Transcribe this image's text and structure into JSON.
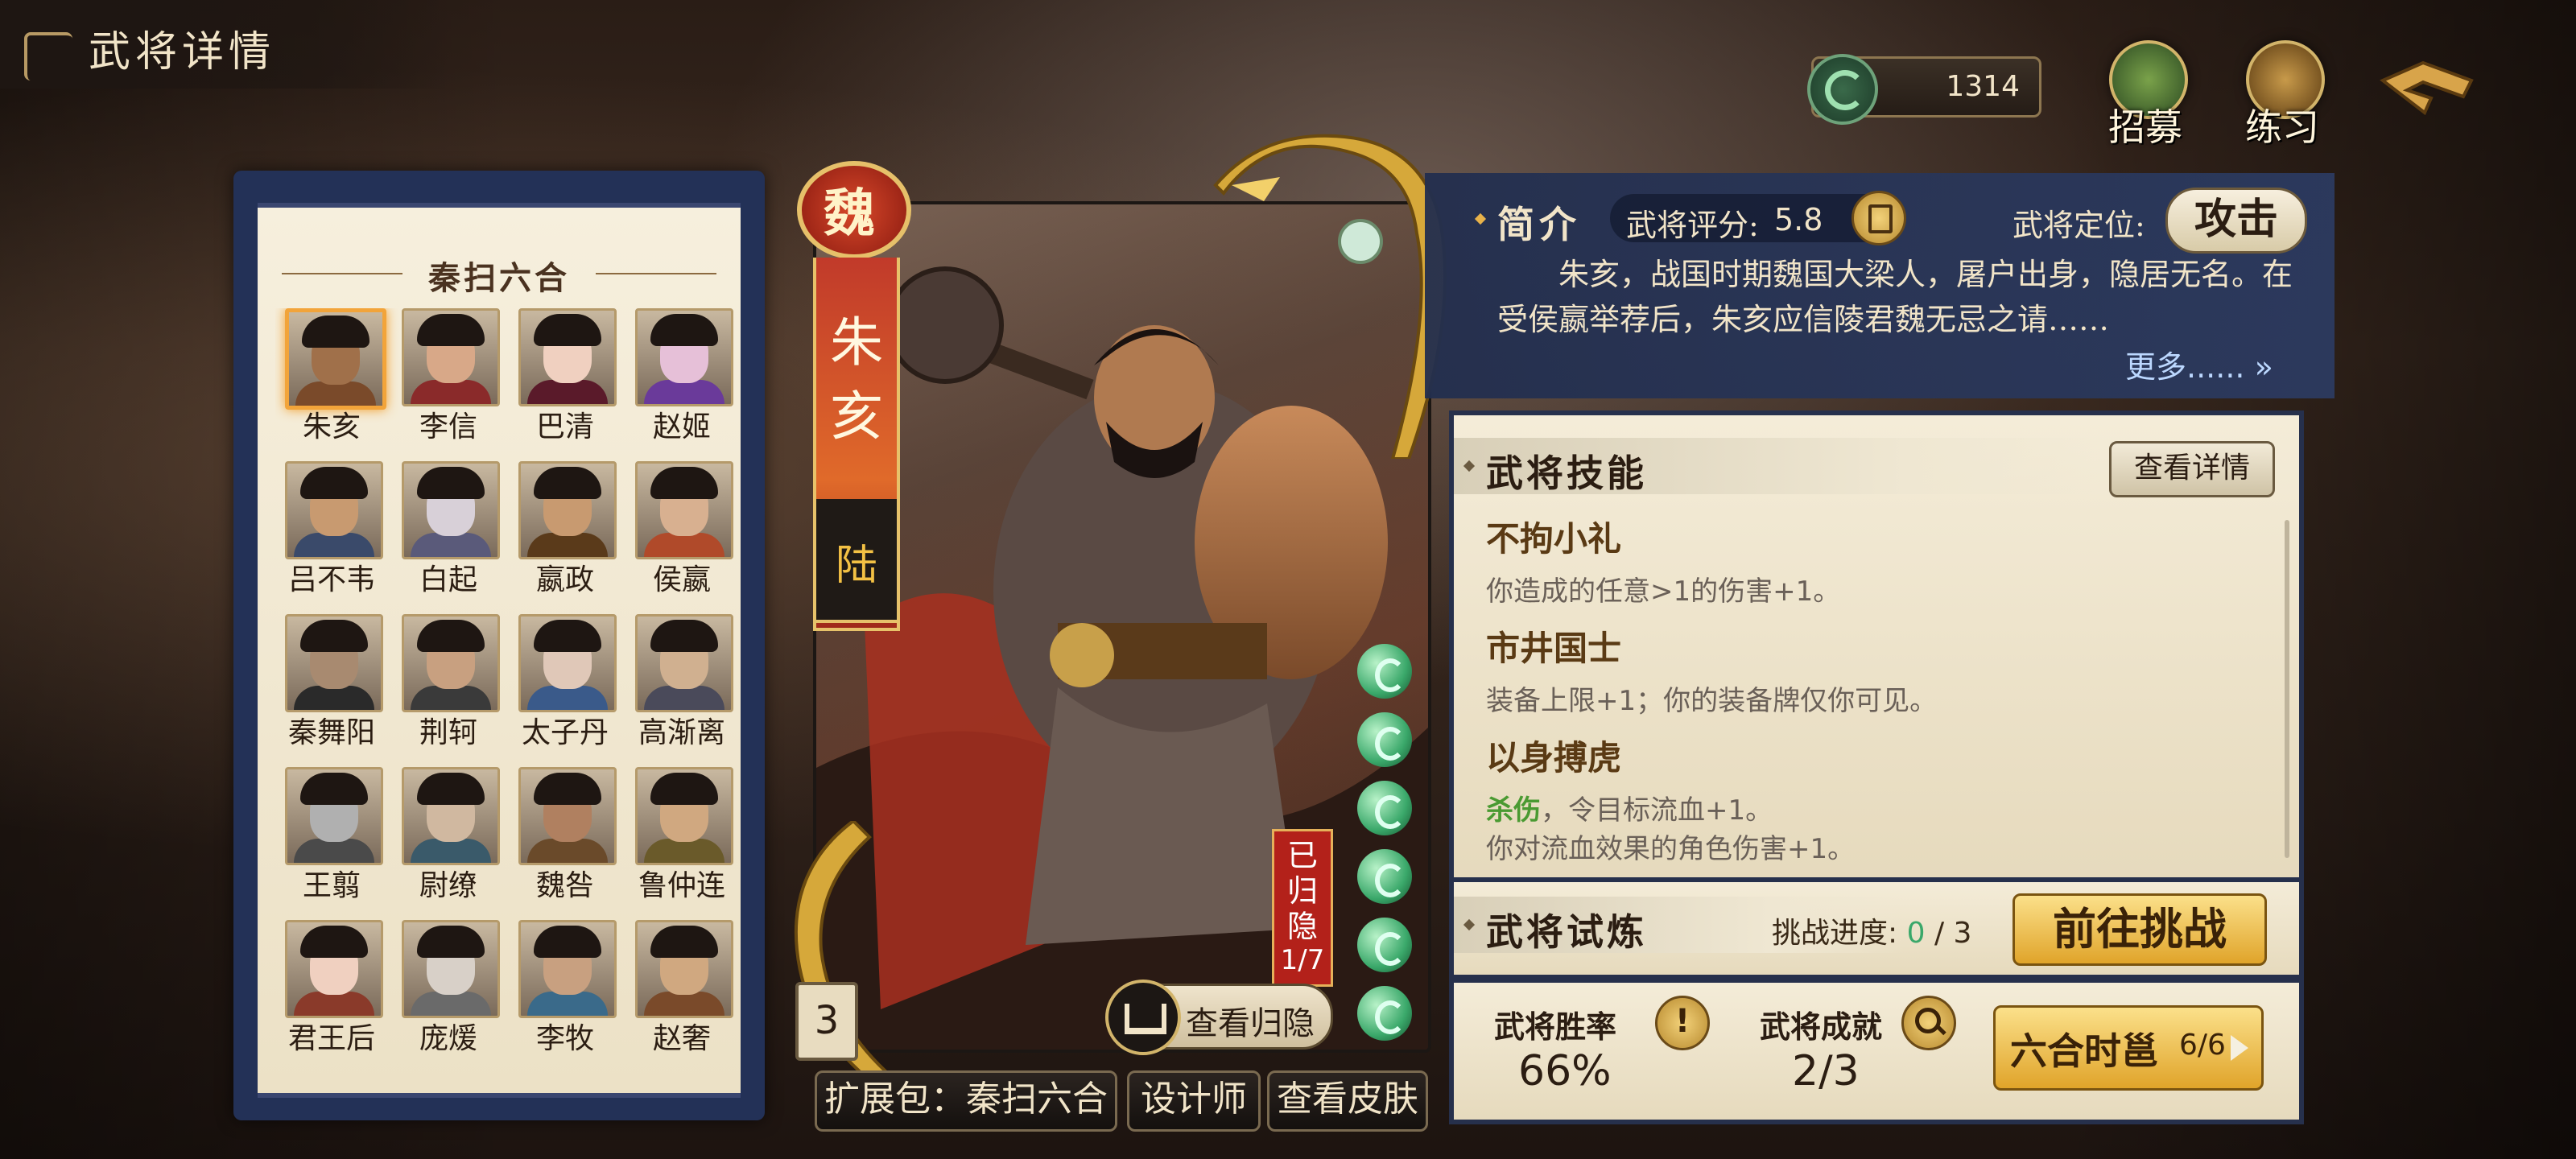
{
  "header": {
    "title": "武将详情"
  },
  "currency": {
    "value": "1314"
  },
  "top_buttons": {
    "recruit": "招募",
    "practice": "练习"
  },
  "roster": {
    "pack_title": "秦扫六合",
    "heroes": [
      {
        "name": "朱亥",
        "selected": true,
        "skin": "#a0704a",
        "cloth": "#7a4a2a"
      },
      {
        "name": "李信",
        "selected": false,
        "skin": "#d8a888",
        "cloth": "#8a2a2a"
      },
      {
        "name": "巴清",
        "selected": false,
        "skin": "#f0d0c0",
        "cloth": "#5a1a2a"
      },
      {
        "name": "赵姬",
        "selected": false,
        "skin": "#e6c0d8",
        "cloth": "#6a3a9a"
      },
      {
        "name": "吕不韦",
        "selected": false,
        "skin": "#c89a70",
        "cloth": "#3a4a6a"
      },
      {
        "name": "白起",
        "selected": false,
        "skin": "#d8d0d8",
        "cloth": "#5a5a7a"
      },
      {
        "name": "嬴政",
        "selected": false,
        "skin": "#c89a70",
        "cloth": "#5a3a1a"
      },
      {
        "name": "侯嬴",
        "selected": false,
        "skin": "#d8b090",
        "cloth": "#b04a2a"
      },
      {
        "name": "秦舞阳",
        "selected": false,
        "skin": "#a88a70",
        "cloth": "#2a2a2a"
      },
      {
        "name": "荆轲",
        "selected": false,
        "skin": "#c8a080",
        "cloth": "#3a3a3a"
      },
      {
        "name": "太子丹",
        "selected": false,
        "skin": "#e0c8b8",
        "cloth": "#3a5a8a"
      },
      {
        "name": "高渐离",
        "selected": false,
        "skin": "#d0b090",
        "cloth": "#4a4a5a"
      },
      {
        "name": "王翦",
        "selected": false,
        "skin": "#b0b0b0",
        "cloth": "#4a4a4a"
      },
      {
        "name": "尉缭",
        "selected": false,
        "skin": "#d0b8a0",
        "cloth": "#3a5a6a"
      },
      {
        "name": "魏咎",
        "selected": false,
        "skin": "#b08060",
        "cloth": "#6a4a2a"
      },
      {
        "name": "鲁仲连",
        "selected": false,
        "skin": "#d0a880",
        "cloth": "#6a5a2a"
      },
      {
        "name": "君王后",
        "selected": false,
        "skin": "#f0d0c0",
        "cloth": "#8a3a2a"
      },
      {
        "name": "庞煖",
        "selected": false,
        "skin": "#d8d0c8",
        "cloth": "#6a6a6a"
      },
      {
        "name": "李牧",
        "selected": false,
        "skin": "#c8a080",
        "cloth": "#3a6a8a"
      },
      {
        "name": "赵奢",
        "selected": false,
        "skin": "#d0a880",
        "cloth": "#7a4a2a"
      }
    ]
  },
  "card": {
    "faction": "魏",
    "name": "朱亥",
    "rank": "陆",
    "level": "3",
    "retired_label": "已归隐",
    "retired_count": "1/7",
    "view_retire_label": "查看归隐"
  },
  "bottom_buttons": {
    "pack": "扩展包：秦扫六合",
    "designer": "设计师",
    "skins": "查看皮肤"
  },
  "intro": {
    "title": "简介",
    "rating_label": "武将评分:",
    "rating_value": "5.8",
    "position_label": "武将定位:",
    "position_value": "攻击",
    "text": "朱亥，战国时期魏国大梁人，屠户出身，隐居无名。在受侯嬴举荐后，朱亥应信陵君魏无忌之请……",
    "more": "更多......"
  },
  "skills": {
    "title": "武将技能",
    "detail_button": "查看详情",
    "items": [
      {
        "name": "不拘小礼",
        "desc": "你造成的任意>1的伤害+1。"
      },
      {
        "name": "市井国士",
        "desc": "装备上限+1；你的装备牌仅你可见。"
      },
      {
        "name": "以身搏虎",
        "keyword": "杀伤",
        "desc1": "，令目标流血+1。",
        "desc2": "你对流血效果的角色伤害+1。"
      }
    ]
  },
  "trial": {
    "title": "武将试炼",
    "progress_label": "挑战进度:",
    "progress_current": "0",
    "progress_total": "/ 3",
    "challenge_button": "前往挑战"
  },
  "stats": {
    "win_rate_label": "武将胜率",
    "win_rate_value": "66%",
    "achievement_label": "武将成就",
    "achievement_value": "2/3",
    "liuhe_label": "六合时邕",
    "liuhe_count": "6/6"
  },
  "colors": {
    "panel_blue": "#26304c",
    "accent_gold": "#e0a42a",
    "green_progress": "#3aa86a",
    "skill_keyword": "#4a9a32"
  }
}
